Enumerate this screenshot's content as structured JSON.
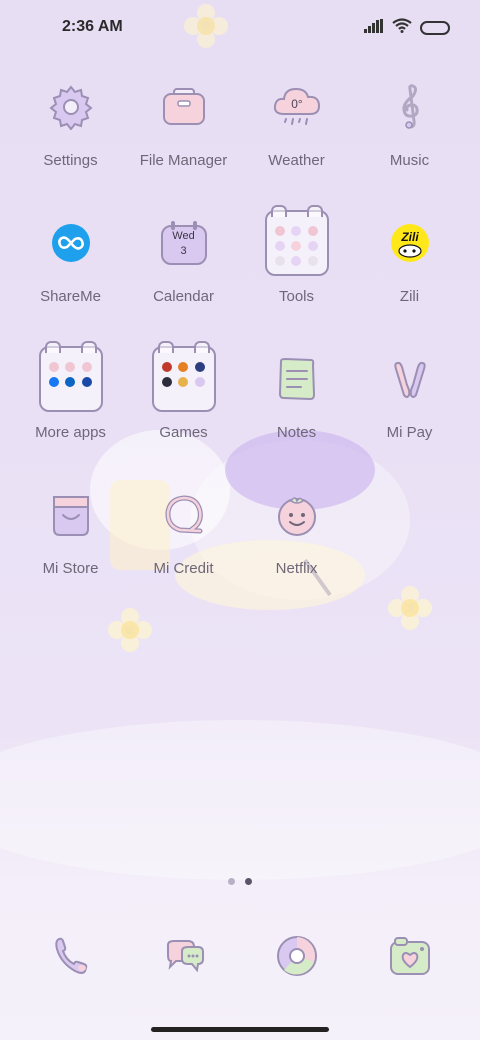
{
  "status_bar": {
    "time": "2:36 AM"
  },
  "apps": [
    {
      "name": "settings",
      "label": "Settings",
      "icon": "gear-icon"
    },
    {
      "name": "file-manager",
      "label": "File Manager",
      "icon": "folder-box-icon"
    },
    {
      "name": "weather",
      "label": "Weather",
      "icon": "cloud-icon",
      "icon_text": "0°"
    },
    {
      "name": "music",
      "label": "Music",
      "icon": "treble-clef-icon"
    },
    {
      "name": "shareme",
      "label": "ShareMe",
      "icon": "infinity-icon"
    },
    {
      "name": "calendar",
      "label": "Calendar",
      "icon": "calendar-icon",
      "day": "Wed",
      "date": "3"
    },
    {
      "name": "tools",
      "label": "Tools",
      "icon": "folder-icon"
    },
    {
      "name": "zili",
      "label": "Zili",
      "icon": "zili-icon",
      "icon_text": "Zili"
    },
    {
      "name": "more-apps",
      "label": "More apps",
      "icon": "folder-icon"
    },
    {
      "name": "games",
      "label": "Games",
      "icon": "folder-icon"
    },
    {
      "name": "notes",
      "label": "Notes",
      "icon": "notepad-icon"
    },
    {
      "name": "mi-pay",
      "label": "Mi Pay",
      "icon": "bunny-ears-icon"
    },
    {
      "name": "mi-store",
      "label": "Mi Store",
      "icon": "store-bag-icon"
    },
    {
      "name": "mi-credit",
      "label": "Mi Credit",
      "icon": "ring-icon"
    },
    {
      "name": "netflix",
      "label": "Netflix",
      "icon": "smiley-face-icon"
    }
  ],
  "pager": {
    "pages": 2,
    "active": 2
  },
  "dock": [
    {
      "name": "phone",
      "icon": "phone-icon"
    },
    {
      "name": "messages",
      "icon": "chat-bubbles-icon"
    },
    {
      "name": "browser",
      "icon": "browser-icon"
    },
    {
      "name": "camera",
      "icon": "camera-icon"
    }
  ],
  "colors": {
    "background": "#e9e0f5",
    "icon_stroke": "#9b8fb4",
    "icon_fill_purple": "#d9c8f0",
    "icon_fill_pink": "#f6d3dc",
    "icon_fill_green": "#d6ecc8",
    "shareme_blue": "#1ea0ec",
    "zili_yellow": "#ffe81a"
  }
}
